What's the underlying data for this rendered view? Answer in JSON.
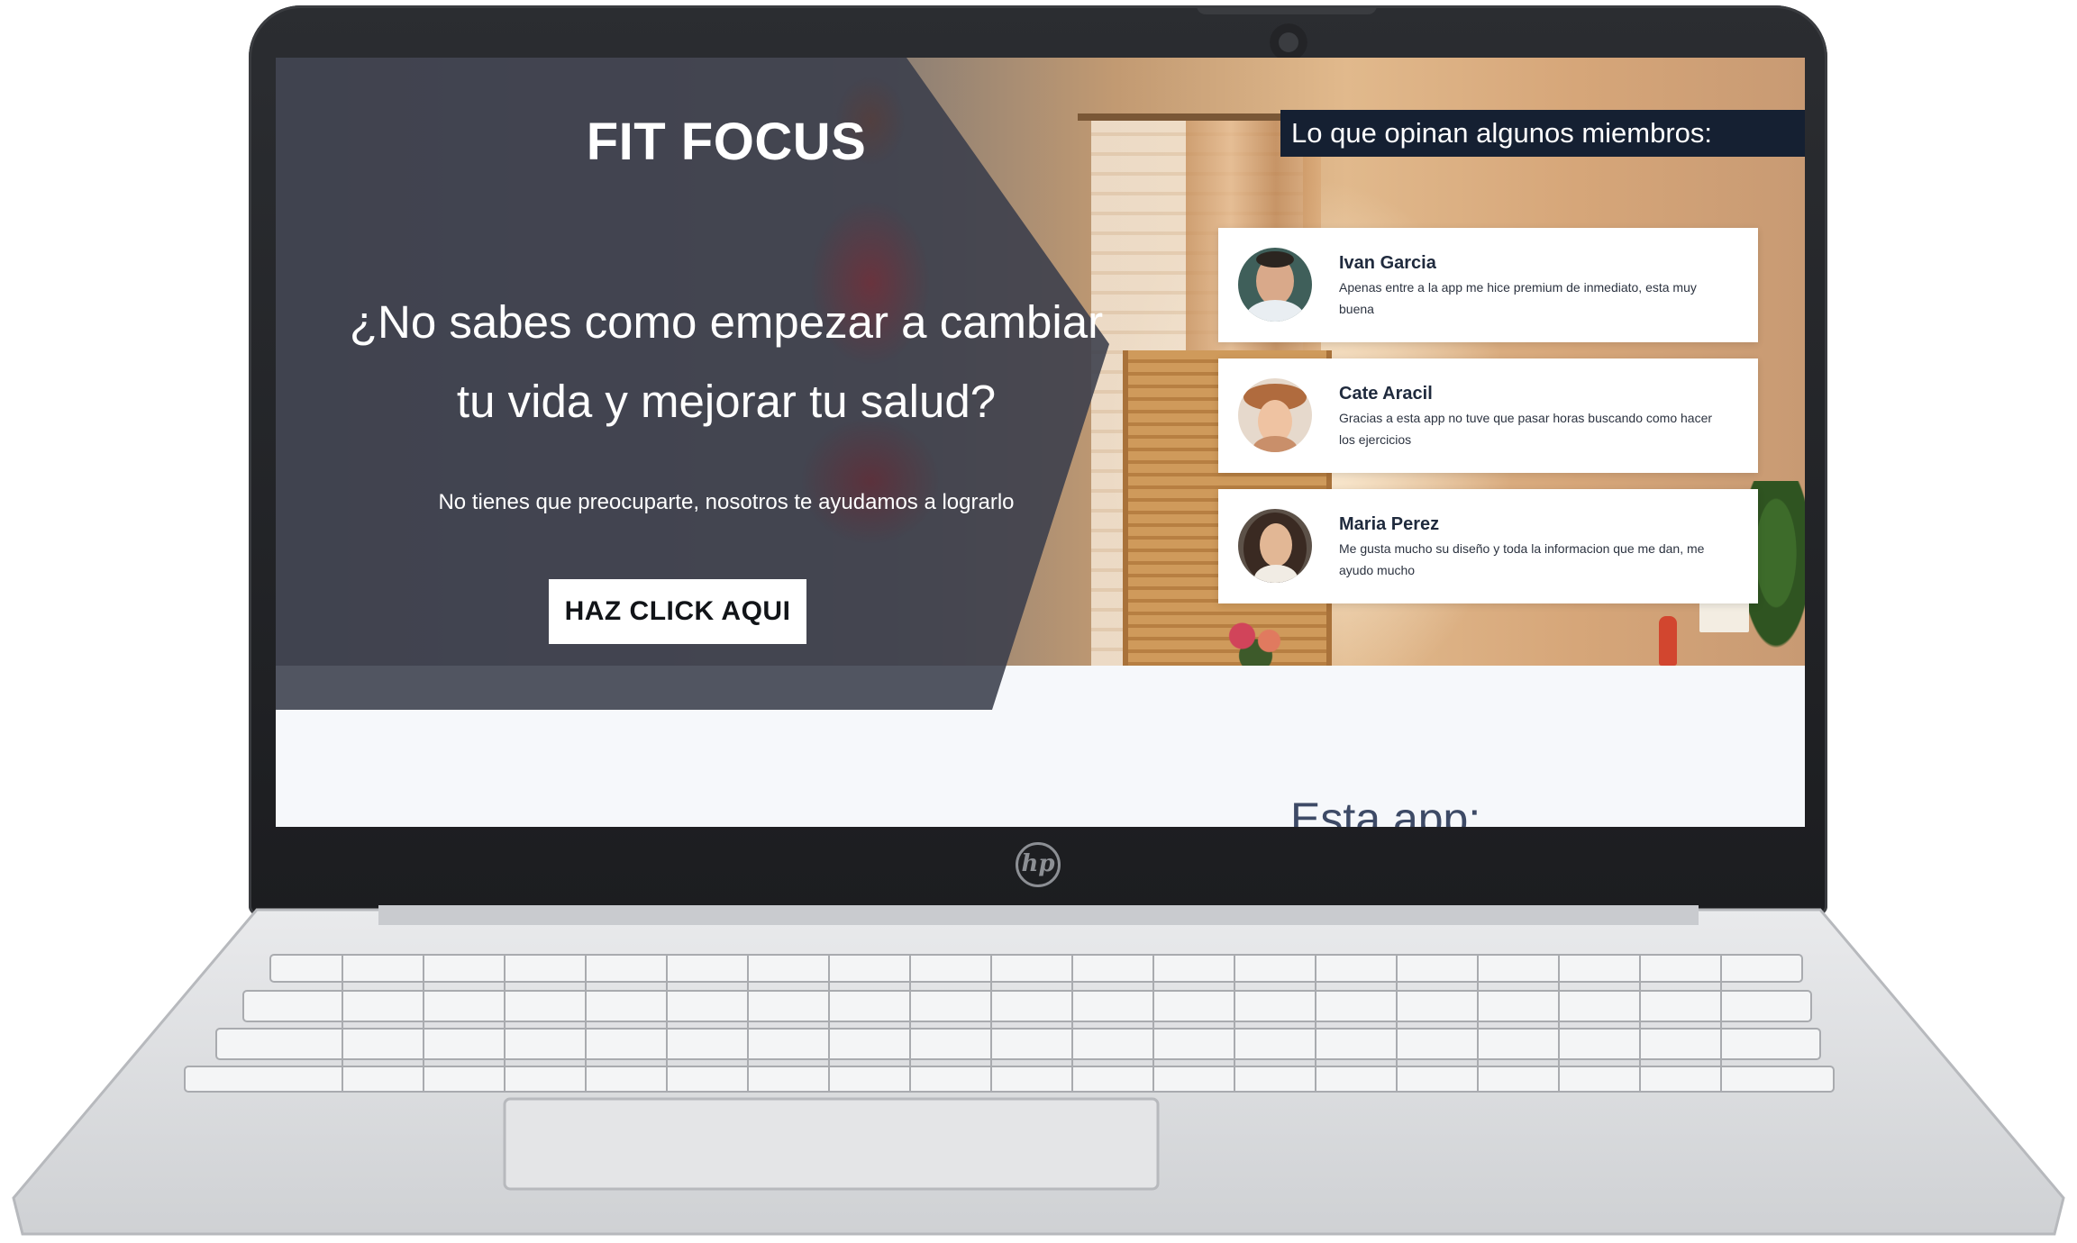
{
  "site": {
    "brand": "FIT FOCUS",
    "headline_line1": "¿No sabes como empezar a cambiar",
    "headline_line2": "tu vida y mejorar tu salud?",
    "subline": "No tienes que preocuparte, nosotros te ayudamos a lograrlo",
    "cta_label": "HAZ CLICK AQUI"
  },
  "testimonials": {
    "title": "Lo que opinan algunos miembros:",
    "items": [
      {
        "name": "Ivan Garcia",
        "quote": "Apenas entre a la app me hice premium de inmediato, esta muy buena"
      },
      {
        "name": "Cate Aracil",
        "quote": "Gracias a esta app no tuve que pasar horas buscando como hacer los ejercicios"
      },
      {
        "name": "Maria Perez",
        "quote": "Me gusta mucho su diseño y toda la informacion que me dan, me ayudo mucho"
      }
    ]
  },
  "section2": {
    "title": "Esta app:"
  },
  "device": {
    "logo_text": "hp"
  },
  "colors": {
    "panel": "#3a3e4b",
    "title_bar": "#152032",
    "page_bg": "#f6f8fb"
  }
}
